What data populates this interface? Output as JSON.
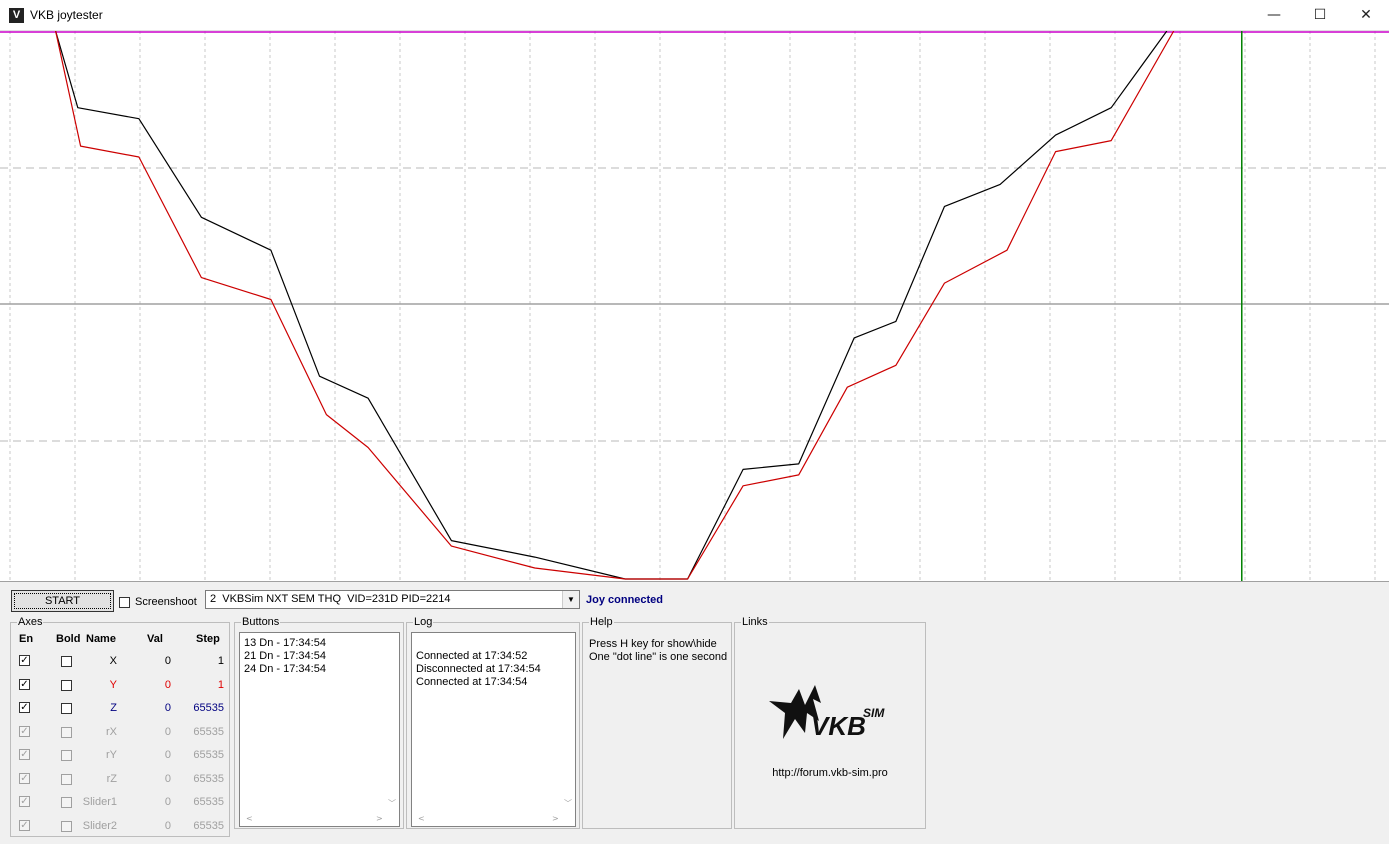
{
  "window": {
    "title": "VKB joytester",
    "minimize": "—",
    "maximize": "☐",
    "close": "✕"
  },
  "toolbar": {
    "start_label": "START",
    "screenshot_label": "Screenshoot",
    "screenshot_checked": false,
    "device_selected": "2  VKBSim NXT SEM THQ  VID=231D PID=2214",
    "status": "Joy connected"
  },
  "axes": {
    "title": "Axes",
    "headers": {
      "en": "En",
      "bold": "Bold",
      "name": "Name",
      "val": "Val",
      "step": "Step"
    },
    "rows": [
      {
        "name": "X",
        "val": "0",
        "step": "1",
        "color": "#000000",
        "enabled": true
      },
      {
        "name": "Y",
        "val": "0",
        "step": "1",
        "color": "#e00000",
        "enabled": true
      },
      {
        "name": "Z",
        "val": "0",
        "step": "65535",
        "color": "#000080",
        "enabled": true
      },
      {
        "name": "rX",
        "val": "0",
        "step": "65535",
        "color": "#a0a0a0",
        "enabled": false
      },
      {
        "name": "rY",
        "val": "0",
        "step": "65535",
        "color": "#a0a0a0",
        "enabled": false
      },
      {
        "name": "rZ",
        "val": "0",
        "step": "65535",
        "color": "#a0a0a0",
        "enabled": false
      },
      {
        "name": "Slider1",
        "val": "0",
        "step": "65535",
        "color": "#a0a0a0",
        "enabled": false
      },
      {
        "name": "Slider2",
        "val": "0",
        "step": "65535",
        "color": "#a0a0a0",
        "enabled": false
      }
    ]
  },
  "buttons": {
    "title": "Buttons",
    "lines": [
      "13 Dn - 17:34:54",
      "21 Dn - 17:34:54",
      "24 Dn - 17:34:54"
    ]
  },
  "log": {
    "title": "Log",
    "lines": [
      "",
      "Connected at 17:34:52",
      "Disconnected at 17:34:54",
      "Connected at 17:34:54"
    ]
  },
  "help": {
    "title": "Help",
    "lines": [
      "Press H key for show\\hide",
      "One \"dot line\" is one second"
    ]
  },
  "links": {
    "title": "Links",
    "logo_text": "VKB",
    "logo_sup": "SIM",
    "url": "http://forum.vkb-sim.pro"
  },
  "colors": {
    "series_x": "#000000",
    "series_y": "#cc0000",
    "top_line": "#cc00cc",
    "cursor": "#008000",
    "status": "#000080"
  },
  "chart_data": {
    "type": "line",
    "ylim": [
      0,
      1
    ],
    "xlim": [
      0,
      1
    ],
    "series": [
      {
        "color": "#000000",
        "points": [
          [
            0.04,
            1.0
          ],
          [
            0.056,
            0.86
          ],
          [
            0.1,
            0.84
          ],
          [
            0.145,
            0.66
          ],
          [
            0.195,
            0.6
          ],
          [
            0.23,
            0.37
          ],
          [
            0.265,
            0.33
          ],
          [
            0.325,
            0.07
          ],
          [
            0.385,
            0.04
          ],
          [
            0.45,
            0.0
          ],
          [
            0.495,
            0.0
          ],
          [
            0.535,
            0.2
          ],
          [
            0.575,
            0.21
          ],
          [
            0.615,
            0.44
          ],
          [
            0.645,
            0.47
          ],
          [
            0.68,
            0.68
          ],
          [
            0.72,
            0.72
          ],
          [
            0.76,
            0.81
          ],
          [
            0.8,
            0.86
          ],
          [
            0.84,
            1.0
          ]
        ]
      },
      {
        "color": "#cc0000",
        "points": [
          [
            0.04,
            1.0
          ],
          [
            0.058,
            0.79
          ],
          [
            0.1,
            0.77
          ],
          [
            0.145,
            0.55
          ],
          [
            0.195,
            0.51
          ],
          [
            0.235,
            0.3
          ],
          [
            0.265,
            0.24
          ],
          [
            0.325,
            0.06
          ],
          [
            0.385,
            0.02
          ],
          [
            0.45,
            0.0
          ],
          [
            0.495,
            0.0
          ],
          [
            0.535,
            0.17
          ],
          [
            0.575,
            0.19
          ],
          [
            0.61,
            0.35
          ],
          [
            0.645,
            0.39
          ],
          [
            0.68,
            0.54
          ],
          [
            0.725,
            0.6
          ],
          [
            0.76,
            0.78
          ],
          [
            0.8,
            0.8
          ],
          [
            0.845,
            1.0
          ]
        ]
      }
    ],
    "cursor_x": 0.894
  }
}
